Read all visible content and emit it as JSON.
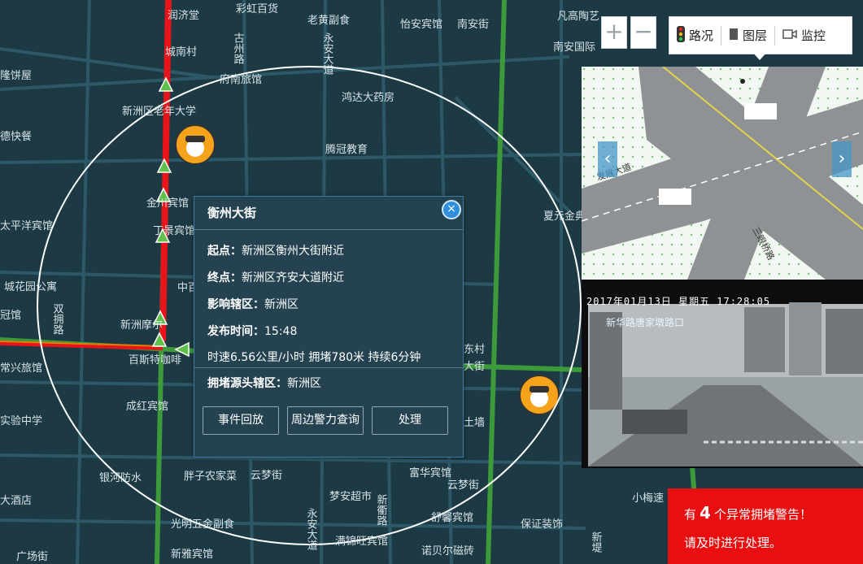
{
  "map": {
    "labels": [
      "润济堂",
      "彩虹百货",
      "老黄副食",
      "怡安宾馆",
      "南安街",
      "凡高陶艺",
      "南安国际",
      "隆饼屋",
      "古州路",
      "城南村",
      "府南旅馆",
      "永安大道",
      "鸿达大药房",
      "德快餐",
      "新洲区老年大学",
      "腾冠教育",
      "金川宾馆",
      "太平洋宾馆",
      "丁景宾馆",
      "夏元金典",
      "城花园公寓",
      "中百",
      "冠馆",
      "新洲摩尔",
      "双拥路",
      "百斯特咖啡",
      "常兴旅馆",
      "东村",
      "大街",
      "实验中学",
      "成红宾馆",
      "土墙",
      "银河防水",
      "胖子农家菜",
      "云梦街",
      "富华宾馆",
      "云梦街",
      "梦安超市",
      "小梅速",
      "大酒店",
      "光明五金副食",
      "新衢路",
      "舒馨宾馆",
      "保证装饰",
      "广场街",
      "新雅宾馆",
      "满锦旺宾馆",
      "诺贝尔磁砖",
      "新堤",
      "永安大道"
    ]
  },
  "zoom": {
    "in": "+",
    "out": "−"
  },
  "toolbar": {
    "traffic": "路况",
    "layers": "图层",
    "monitor": "监控"
  },
  "crossview": {
    "road_a": "发展大道",
    "road_b": "三眼桥路"
  },
  "camera": {
    "timestamp": "2017年01月13日  星期五  17:28:05",
    "location": "新华路唐家墩路口"
  },
  "popup": {
    "title": "衡州大街",
    "start_label": "起点：",
    "start": "新洲区衡州大街附近",
    "end_label": "终点：",
    "end": "新洲区齐安大道附近",
    "district_label": "影响辖区：",
    "district": "新洲区",
    "time_label": "发布时间：",
    "time": "15:48",
    "stats": "时速6.56公里/小时 拥堵780米 持续6分钟",
    "source_label": "拥堵源头辖区：",
    "source": "新洲区",
    "buttons": [
      "事件回放",
      "周边警力查询",
      "处理"
    ],
    "close": "×"
  },
  "alert": {
    "prefix": "有",
    "count": "4",
    "suffix": "个异常拥堵警告！",
    "line2": "请及时进行处理。"
  },
  "colors": {
    "map_bg": "#1d3a44",
    "road_green": "#3c9a3a",
    "congestion_red": "#e8141a",
    "alert_red": "#e90f10",
    "popup_bg": "#244250"
  }
}
